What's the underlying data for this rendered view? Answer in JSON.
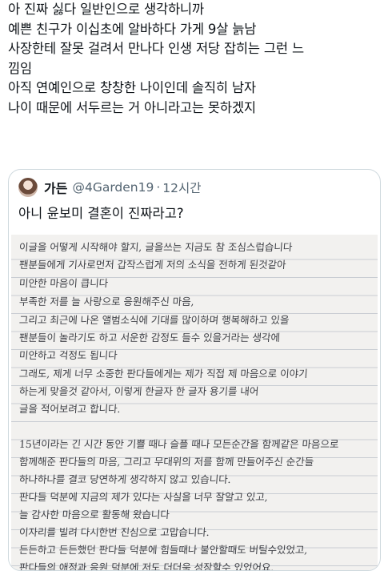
{
  "tweet": {
    "lines": [
      "아 진짜 싫다 일반인으로 생각하니까",
      "예쁜 친구가 이십초에 알바하다 가게 9살 늙남",
      "사장한테 잘못 걸려서 만나다 인생 저당 잡히는 그런 느",
      "낌임",
      "아직 연예인으로 창창한 나이인데 솔직히 남자",
      "나이 때문에 서두르는 거 아니라고는 못하겠지"
    ]
  },
  "quote": {
    "display_name": "가든",
    "handle": "@4Garden19",
    "separator": "·",
    "time": "12시간",
    "text": "아니 윤보미 결혼이 진짜라고?",
    "letter_lines": [
      "이글을 어떻게 시작해야 할지, 글을쓰는 지금도 참 조심스럽습니다",
      "팬분들에게 기사로먼저 갑작스럽게 저의 소식을 전하게 된것같아",
      "미안한 마음이 큽니다",
      "부족한 저를 늘 사랑으로 응원해주신 마음,",
      "그리고 최근에 나온 앨범소식에 기대를 많이하며 행복해하고 있을",
      "팬분들이 놀라기도 하고 서운한 감정도 들수 있을거라는 생각에",
      "미안하고 걱정도 됩니다",
      "그래도, 제게 너무 소중한 판다들에게는 제가 직접 제 마음으로 이야기",
      "하는게 맞을것 같아서, 이렇게 한글자 한 글자 용기를 내어",
      "글을 적어보려고 합니다.",
      "",
      "15년이라는 긴 시간 동안 기쁠 때나 슬플 때나 모든순간을 함께같은 마음으로",
      "함께해준 판다들의 마음, 그리고 무대위의 저를 함께 만들어주신 순간들",
      "하나하나를 결코 당연하게 생각하지 않고 있습니다.",
      "판다들 덕분에 지금의 제가 있다는 사실을 너무 잘알고 있고,",
      "늘 감사한 마음으로 활동해 왔습니다",
      "이자리를 빌려 다시한번 진심으로 고맙습니다.",
      "든든하고 든든했던 판다들 덕분에 힘들때나 불안할때도 버틸수있었고,",
      "판다들의 애정과 응원 덕분에 저도 더더욱 성장할수 있었어요."
    ]
  }
}
